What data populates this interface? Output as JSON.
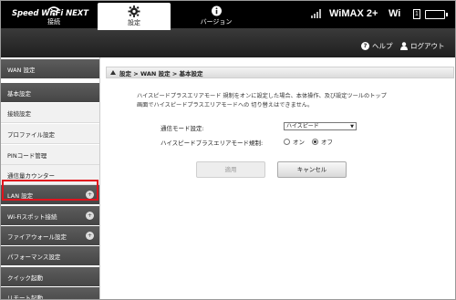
{
  "header": {
    "logo": "Speed Wi-Fi NEXT",
    "network_label": "WiMAX 2+",
    "wifi_label": "Wi",
    "wifi_client_count": "1"
  },
  "nav": {
    "tabs": [
      {
        "label": "接続",
        "icon": "wifi-icon",
        "active": false
      },
      {
        "label": "設定",
        "icon": "gear-icon",
        "active": true
      },
      {
        "label": "バージョン",
        "icon": "info-icon",
        "active": false
      }
    ],
    "help_label": "ヘルプ",
    "logout_label": "ログアウト"
  },
  "sidebar": {
    "items": [
      {
        "label": "WAN 設定",
        "type": "section"
      },
      {
        "label": "基本設定",
        "type": "section"
      },
      {
        "label": "接続設定",
        "type": "sub"
      },
      {
        "label": "プロファイル設定",
        "type": "sub",
        "highlighted": true
      },
      {
        "label": "PINコード管理",
        "type": "sub"
      },
      {
        "label": "通信量カウンター",
        "type": "sub"
      },
      {
        "label": "LAN 設定",
        "type": "section",
        "expandable": true
      },
      {
        "label": "Wi-Fiスポット接続",
        "type": "section",
        "expandable": true
      },
      {
        "label": "ファイアウォール設定",
        "type": "section",
        "expandable": true
      },
      {
        "label": "パフォーマンス設定",
        "type": "section"
      },
      {
        "label": "クイック起動",
        "type": "section"
      },
      {
        "label": "リモート起動",
        "type": "section"
      }
    ],
    "expand_glyph": "+"
  },
  "main": {
    "breadcrumb": "設定 > WAN 設定 > 基本設定",
    "description_line1": "ハイスピードプラスエリアモード 規制をオンに設定した場合、本体操作、及び設定ツールのトップ",
    "description_line2": "画面でハイスピードプラスエリアモードへの 切り替えはできません。",
    "mode_label": "通信モード設定:",
    "mode_value": "ハイスピード",
    "restriction_label": "ハイスピードプラスエリアモード規制:",
    "on_label": "オン",
    "off_label": "オフ",
    "restriction_selected": "off",
    "apply_label": "適用",
    "cancel_label": "キャンセル"
  }
}
